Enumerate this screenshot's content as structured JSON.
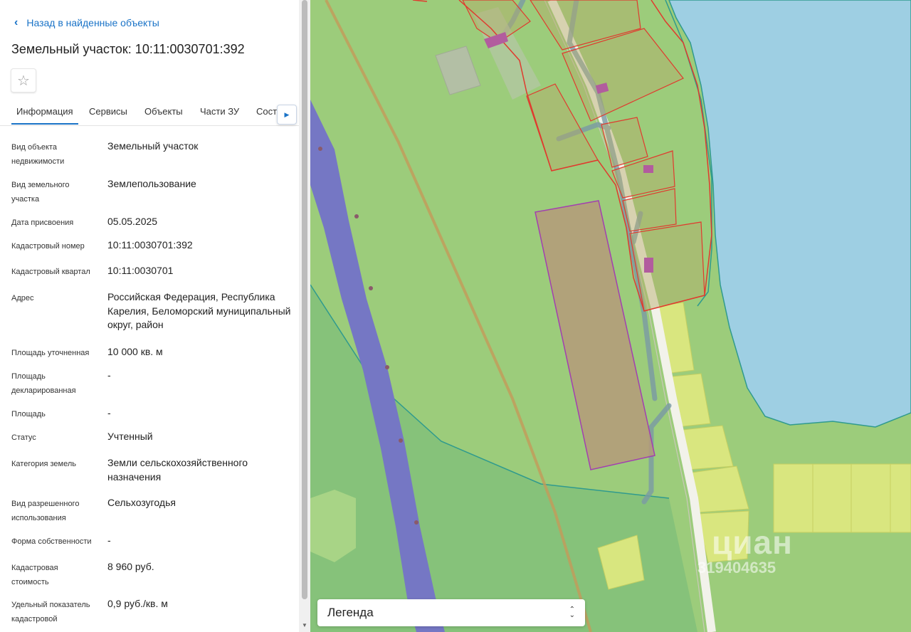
{
  "header": {
    "back_label": "Назад в найденные объекты",
    "title": "Земельный участок: 10:11:0030701:392"
  },
  "tabs": [
    {
      "label": "Информация",
      "active": true
    },
    {
      "label": "Сервисы",
      "active": false
    },
    {
      "label": "Объекты",
      "active": false
    },
    {
      "label": "Части ЗУ",
      "active": false
    },
    {
      "label": "Состав",
      "active": false
    }
  ],
  "properties": [
    {
      "label": "Вид объекта недвижимости",
      "value": "Земельный участок"
    },
    {
      "label": "Вид земельного участка",
      "value": "Землепользование"
    },
    {
      "label": "Дата присвоения",
      "value": "05.05.2025"
    },
    {
      "label": "Кадастровый номер",
      "value": "10:11:0030701:392"
    },
    {
      "label": "Кадастровый квартал",
      "value": "10:11:0030701"
    },
    {
      "label": "Адрес",
      "value": "Российская Федерация, Республика Карелия, Беломорский муниципальный округ, район"
    },
    {
      "label": "Площадь уточненная",
      "value": "10 000 кв. м"
    },
    {
      "label": "Площадь декларированная",
      "value": "-"
    },
    {
      "label": "Площадь",
      "value": "-"
    },
    {
      "label": "Статус",
      "value": "Учтенный"
    },
    {
      "label": "Категория земель",
      "value": "Земли сельскохозяйственного назначения"
    },
    {
      "label": "Вид разрешенного использования",
      "value": "Сельхозугодья"
    },
    {
      "label": "Форма собственности",
      "value": "-"
    },
    {
      "label": "Кадастровая стоимость",
      "value": "8 960 руб."
    },
    {
      "label": "Удельный показатель кадастровой",
      "value": "0,9 руб./кв. м"
    }
  ],
  "map": {
    "legend_label": "Легенда",
    "watermark_logo": "циан",
    "watermark_code": "319404635",
    "colors": {
      "land": "#9ccc7b",
      "water": "#9ecfe3",
      "highlight_parcel": "#b59a7a",
      "road": "#7577c4",
      "parcel_border": "#e03a2e",
      "yellow_parcel": "#dde880"
    }
  },
  "icons": {
    "back": "chevron-left-icon",
    "favorite": "star-outline-icon",
    "tabs_next": "caret-right-icon",
    "legend_toggle": "updown-chevron-icon"
  }
}
